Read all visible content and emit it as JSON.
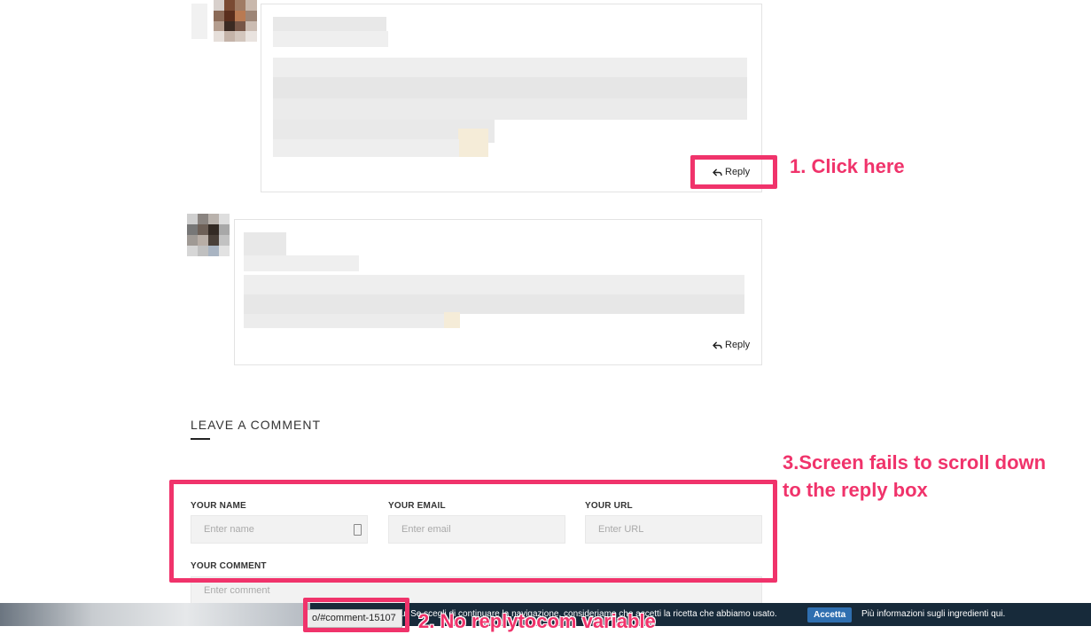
{
  "comments": [
    {
      "reply_label": "Reply"
    },
    {
      "reply_label": "Reply"
    }
  ],
  "annotations": {
    "step1": "1. Click here",
    "step2": "2. No replytocom variable",
    "step3_line1": "3.Screen fails to scroll down",
    "step3_line2": "to the reply box"
  },
  "leave_comment": {
    "title": "LEAVE A COMMENT",
    "name_label": "YOUR NAME",
    "name_placeholder": "Enter name",
    "email_label": "YOUR EMAIL",
    "email_placeholder": "Enter email",
    "url_label": "YOUR URL",
    "url_placeholder": "Enter URL",
    "comment_label": "YOUR COMMENT",
    "comment_placeholder": "Enter comment"
  },
  "cookie_bar": {
    "text_fragment": "u. Se scegli di continuare la navigazione, consideriamo che accetti la ricetta che abbiamo usato.",
    "accept_label": "Accetta",
    "more_info": "Più informazioni sugli ingredienti qui."
  },
  "status_bar": {
    "url_fragment": "#comment-15107",
    "url_prefix": "o/"
  },
  "colors": {
    "annotation": "#f0336b",
    "cookie_bar_bg": "#172a3a",
    "accept_btn": "#2f6fb0"
  }
}
